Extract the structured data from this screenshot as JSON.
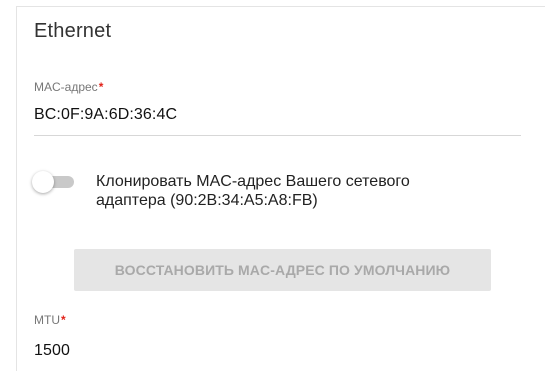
{
  "section": {
    "title": "Ethernet"
  },
  "mac_field": {
    "label": "MAC-адрес",
    "required_mark": "*",
    "value": "BC:0F:9A:6D:36:4C"
  },
  "clone_toggle": {
    "state": "off",
    "label_line1": "Клонировать MAC-адрес Вашего сетевого",
    "label_line2": "адаптера (90:2B:34:A5:A8:FB)"
  },
  "restore_button": {
    "label": "ВОССТАНОВИТЬ MAC-АДРЕС ПО УМОЛЧАНИЮ",
    "state": "disabled"
  },
  "mtu_field": {
    "label": "MTU",
    "required_mark": "*",
    "value": "1500"
  },
  "colors": {
    "required_mark": "#e2231a",
    "button_disabled_bg": "#e5e5e5",
    "button_disabled_text": "#a9a9a9",
    "toggle_track_off": "#c9c9c9"
  }
}
